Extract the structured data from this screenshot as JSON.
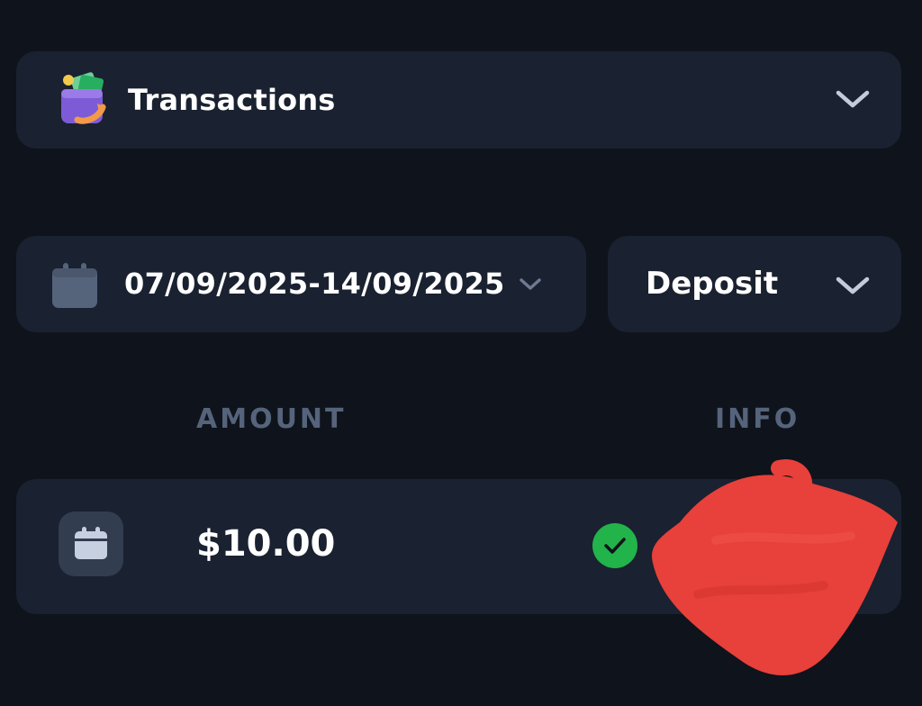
{
  "header": {
    "title": "Transactions",
    "icon": "wallet-icon"
  },
  "filters": {
    "date_range": "07/09/2025-14/09/2025",
    "type": "Deposit"
  },
  "columns": [
    "AMOUNT",
    "INFO"
  ],
  "transactions": [
    {
      "amount": "$10.00",
      "status": "success"
    }
  ],
  "colors": {
    "background": "#0f131b",
    "card": "#1a2130",
    "muted": "#55637b",
    "success": "#22b34a",
    "redaction": "#e8403a"
  }
}
